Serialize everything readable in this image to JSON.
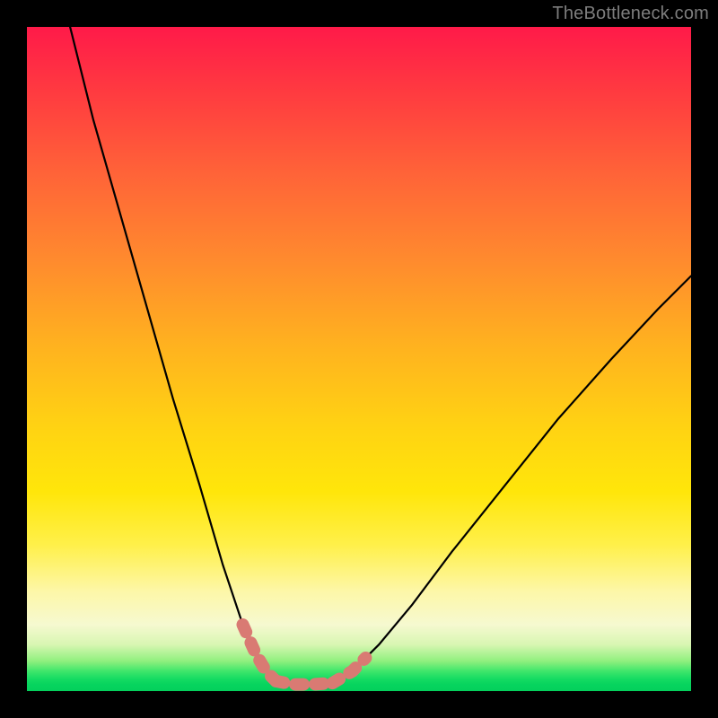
{
  "watermark": "TheBottleneck.com",
  "chart_data": {
    "type": "line",
    "title": "",
    "xlabel": "",
    "ylabel": "",
    "xlim": [
      0,
      1
    ],
    "ylim": [
      0,
      1
    ],
    "note": "No numeric axes or tick labels are shown. The chart is a V-shaped bottleneck curve over a vertical red→green gradient. Values below are normalized [0..1] in plot-area coordinates (x left→right, y bottom→top).",
    "series": [
      {
        "name": "left-branch",
        "x": [
          0.065,
          0.1,
          0.14,
          0.18,
          0.22,
          0.26,
          0.295,
          0.325,
          0.345,
          0.36,
          0.375
        ],
        "y": [
          1.0,
          0.86,
          0.72,
          0.58,
          0.44,
          0.31,
          0.19,
          0.1,
          0.055,
          0.03,
          0.015
        ]
      },
      {
        "name": "valley-floor",
        "x": [
          0.375,
          0.4,
          0.43,
          0.46
        ],
        "y": [
          0.015,
          0.01,
          0.01,
          0.012
        ]
      },
      {
        "name": "right-branch",
        "x": [
          0.46,
          0.49,
          0.53,
          0.58,
          0.64,
          0.72,
          0.8,
          0.88,
          0.95,
          1.0
        ],
        "y": [
          0.012,
          0.03,
          0.07,
          0.13,
          0.21,
          0.31,
          0.41,
          0.5,
          0.575,
          0.625
        ]
      }
    ],
    "markers": {
      "name": "salmon-dashed-highlight",
      "color": "#d97a73",
      "segments": [
        {
          "on": "left-branch",
          "x_range": [
            0.325,
            0.375
          ]
        },
        {
          "on": "valley-floor",
          "x_range": [
            0.375,
            0.46
          ]
        },
        {
          "on": "right-branch",
          "x_range": [
            0.46,
            0.51
          ]
        }
      ]
    }
  }
}
